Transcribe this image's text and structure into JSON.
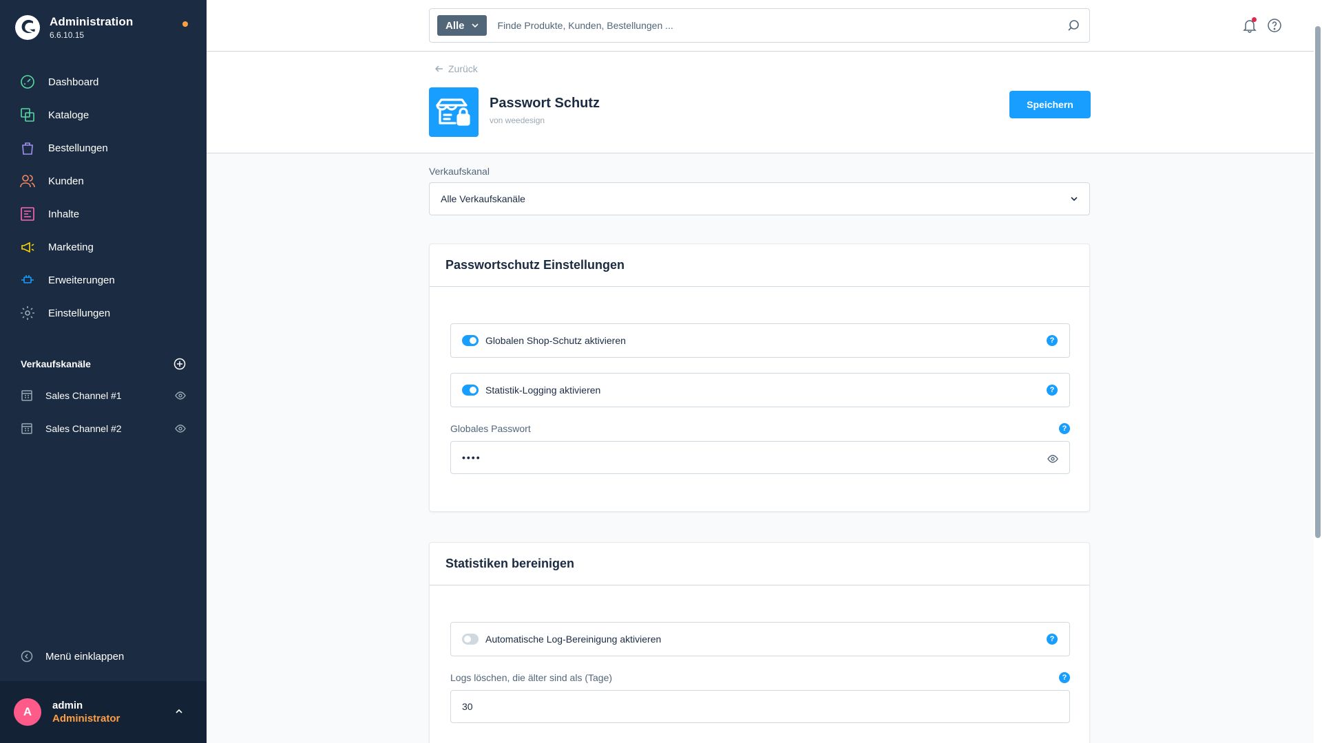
{
  "brand": {
    "title": "Administration",
    "version": "6.6.10.15"
  },
  "nav": [
    {
      "label": "Dashboard",
      "icon": "dashboard-icon",
      "color": "#57d9a3"
    },
    {
      "label": "Kataloge",
      "icon": "catalogue-icon",
      "color": "#57d9a3"
    },
    {
      "label": "Bestellungen",
      "icon": "orders-icon",
      "color": "#a092f0"
    },
    {
      "label": "Kunden",
      "icon": "customers-icon",
      "color": "#f88962"
    },
    {
      "label": "Inhalte",
      "icon": "content-icon",
      "color": "#ff68b4"
    },
    {
      "label": "Marketing",
      "icon": "marketing-icon",
      "color": "#ffd700"
    },
    {
      "label": "Erweiterungen",
      "icon": "extensions-icon",
      "color": "#189eff"
    },
    {
      "label": "Einstellungen",
      "icon": "settings-icon",
      "color": "#9aa8b5"
    }
  ],
  "sales_channels": {
    "heading": "Verkaufskanäle",
    "items": [
      {
        "label": "Sales Channel #1"
      },
      {
        "label": "Sales Channel #2"
      }
    ]
  },
  "collapse_label": "Menü einklappen",
  "user": {
    "initial": "A",
    "name": "admin",
    "role": "Administrator"
  },
  "search": {
    "type_label": "Alle",
    "placeholder": "Finde Produkte, Kunden, Bestellungen ..."
  },
  "page": {
    "back_label": "Zurück",
    "title": "Passwort Schutz",
    "author": "von weedesign",
    "save_label": "Speichern"
  },
  "sales_channel_select": {
    "label": "Verkaufskanal",
    "value": "Alle Verkaufskanäle"
  },
  "card_password": {
    "title": "Passwortschutz Einstellungen",
    "switch_global": {
      "label": "Globalen Shop-Schutz aktivieren",
      "checked": true
    },
    "switch_stats": {
      "label": "Statistik-Logging aktivieren",
      "checked": true
    },
    "password": {
      "label": "Globales Passwort",
      "value": "••••"
    }
  },
  "card_stats": {
    "title": "Statistiken bereinigen",
    "switch_cleanup": {
      "label": "Automatische Log-Bereinigung aktivieren",
      "checked": false
    },
    "days": {
      "label": "Logs löschen, die älter sind als (Tage)",
      "value": "30"
    }
  },
  "colors": {
    "accent": "#189eff",
    "sidebar_bg": "#1b2b42",
    "warning": "#ff9f43",
    "avatar": "#ff5b8a"
  }
}
